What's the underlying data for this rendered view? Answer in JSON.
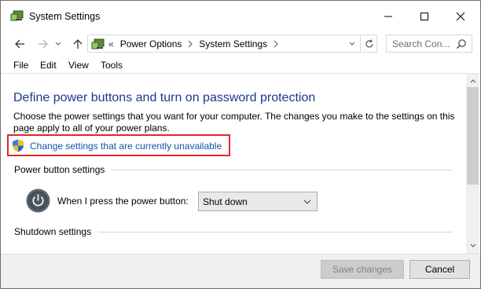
{
  "window": {
    "title": "System Settings",
    "icon": "power-options-icon"
  },
  "nav": {
    "breadcrumb_sep": "«",
    "crumbs": [
      "Power Options",
      "System Settings"
    ],
    "search_placeholder": "Search Con..."
  },
  "menu": {
    "items": [
      "File",
      "Edit",
      "View",
      "Tools"
    ]
  },
  "content": {
    "heading": "Define power buttons and turn on password protection",
    "description": "Choose the power settings that you want for your computer. The changes you make to the settings on this page apply to all of your power plans.",
    "change_link": "Change settings that are currently unavailable",
    "power_section_title": "Power button settings",
    "power_label": "When I press the power button:",
    "power_select_value": "Shut down",
    "shutdown_section_title": "Shutdown settings"
  },
  "footer": {
    "save_label": "Save changes",
    "cancel_label": "Cancel"
  },
  "colors": {
    "heading": "#1a3a8c",
    "link": "#0b57a8",
    "highlight_border": "#e0262e"
  }
}
